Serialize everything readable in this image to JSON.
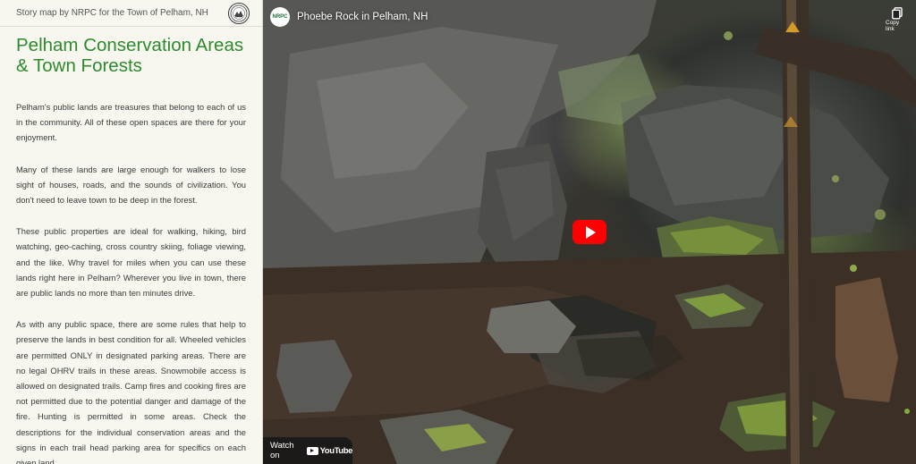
{
  "sidebar": {
    "byline": "Story map by NRPC for the Town of Pelham, NH",
    "title": "Pelham Conservation Areas & Town Forests",
    "paragraphs": [
      "Pelham's public lands are treasures that belong to each of us in the community. All of these open spaces are there for your enjoyment.",
      "Many of these lands are large enough for walkers to lose sight of houses, roads, and the sounds of civilization. You don't need to leave town to be deep in the forest.",
      "These public properties are ideal for walking, hiking, bird watching, geo-caching, cross country skiing, foliage viewing, and the like. Why travel for miles when you can use these lands right here in Pelham? Wherever you live in town, there are public lands no more than ten minutes drive.",
      "As with any public space, there are some rules that help to preserve the lands in best condition for all. Wheeled vehicles are permitted ONLY in designated parking areas. There are no legal OHRV trails in these areas. Snowmobile access is allowed on designated trails. Camp fires and cooking fires are not permitted due to the potential danger and damage of the fire. Hunting is permitted in some areas. Check the descriptions for the individual conservation areas and the signs in each trail head parking area for specifics on each given land."
    ]
  },
  "video": {
    "channel_avatar_text": "NRPC",
    "title": "Phoebe Rock in Pelham, NH",
    "copy_link_label": "Copy link",
    "watch_on_label": "Watch on",
    "youtube_label": "YouTube"
  },
  "colors": {
    "title_green": "#2d8a2d",
    "play_red": "#ff0000",
    "sidebar_bg": "#f7f7f0"
  },
  "icons": {
    "logo": "town-seal-icon",
    "copy": "copy-icon",
    "play": "play-icon",
    "youtube": "youtube-icon"
  }
}
